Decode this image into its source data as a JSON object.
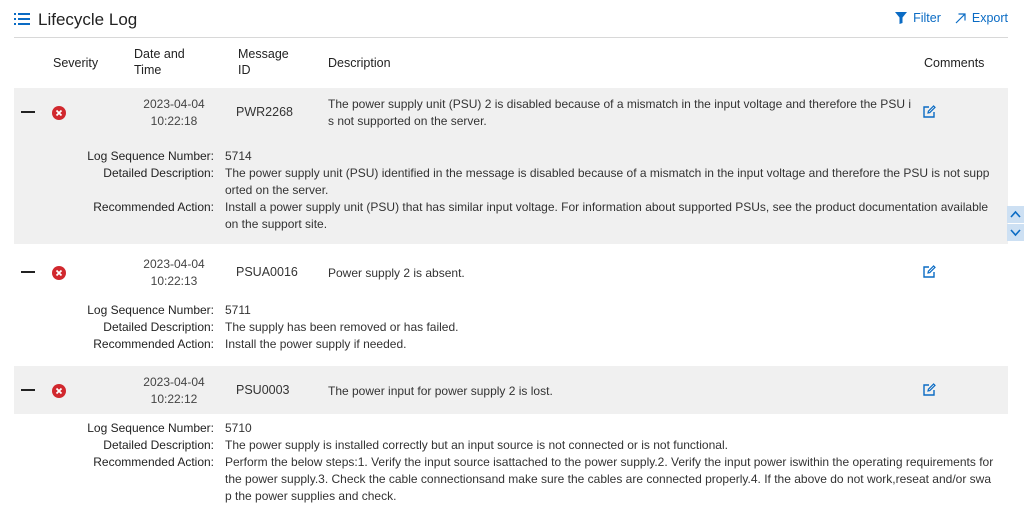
{
  "header": {
    "title": "Lifecycle Log",
    "icon": "list-icon",
    "filter_label": "Filter",
    "export_label": "Export",
    "accent_color": "#0a6bc4"
  },
  "columns": {
    "severity": "Severity",
    "date_time": "Date and Time",
    "message_id": "Message ID",
    "description": "Description",
    "comments": "Comments"
  },
  "detail_labels": {
    "seq": "Log Sequence Number:",
    "detailed": "Detailed Description:",
    "action": "Recommended Action:"
  },
  "entries": [
    {
      "severity": "critical",
      "severity_color": "#d1282e",
      "date": "2023-04-04",
      "time": "10:22:18",
      "message_id": "PWR2268",
      "description": "The power supply unit (PSU) 2 is disabled because of a mismatch in the input voltage and therefore the PSU is not supported on the server.",
      "seq": "5714",
      "detailed": "The power supply unit (PSU) identified in the message is disabled because of a mismatch in the input voltage and therefore the PSU is not supported on the server.",
      "action": "Install a power supply unit (PSU) that has similar input voltage. For information about supported PSUs, see the product documentation available on the support site."
    },
    {
      "severity": "critical",
      "severity_color": "#d1282e",
      "date": "2023-04-04",
      "time": "10:22:13",
      "message_id": "PSUA0016",
      "description": "Power supply 2 is absent.",
      "seq": "5711",
      "detailed": "The supply has been removed or has failed.",
      "action": "Install the power supply if needed."
    },
    {
      "severity": "critical",
      "severity_color": "#d1282e",
      "date": "2023-04-04",
      "time": "10:22:12",
      "message_id": "PSU0003",
      "description": "The power input for power supply 2 is lost.",
      "seq": "5710",
      "detailed": "The power supply is installed correctly but an input source is not connected or is not functional.",
      "action": "Perform the below steps:1. Verify the input source isattached to the power supply.2. Verify the input power iswithin the operating requirements for the power supply.3. Check the cable connectionsand make sure the cables are connected properly.4. If the above do not work,reseat and/or swap the power supplies and check."
    }
  ]
}
